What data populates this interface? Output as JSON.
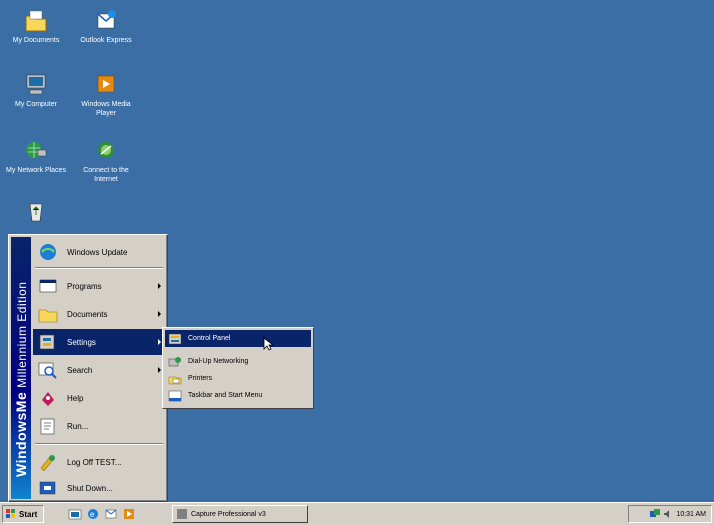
{
  "desktop": {
    "icons": [
      {
        "label": "My Documents"
      },
      {
        "label": "Outlook Express"
      },
      {
        "label": "My Computer"
      },
      {
        "label": "Windows Media Player"
      },
      {
        "label": "My Network Places"
      },
      {
        "label": "Connect to the Internet"
      },
      {
        "label": ""
      }
    ]
  },
  "start_menu": {
    "banner_brand": "Windows",
    "banner_edition": "Me",
    "banner_suffix": "Millennium Edition",
    "items": [
      {
        "label": "Windows Update"
      },
      {
        "label": "Programs"
      },
      {
        "label": "Documents"
      },
      {
        "label": "Settings"
      },
      {
        "label": "Search"
      },
      {
        "label": "Help"
      },
      {
        "label": "Run..."
      },
      {
        "label": "Log Off TEST..."
      },
      {
        "label": "Shut Down..."
      }
    ]
  },
  "settings_submenu": {
    "items": [
      {
        "label": "Control Panel"
      },
      {
        "label": "Dial-Up Networking"
      },
      {
        "label": "Printers"
      },
      {
        "label": "Taskbar and Start Menu"
      }
    ]
  },
  "taskbar": {
    "start_label": "Start",
    "task_label": "Capture Professional v3",
    "clock": "10:31 AM"
  },
  "colors": {
    "desktop": "#3a6ea5",
    "highlight": "#0a246a",
    "face": "#d4d0c8"
  }
}
